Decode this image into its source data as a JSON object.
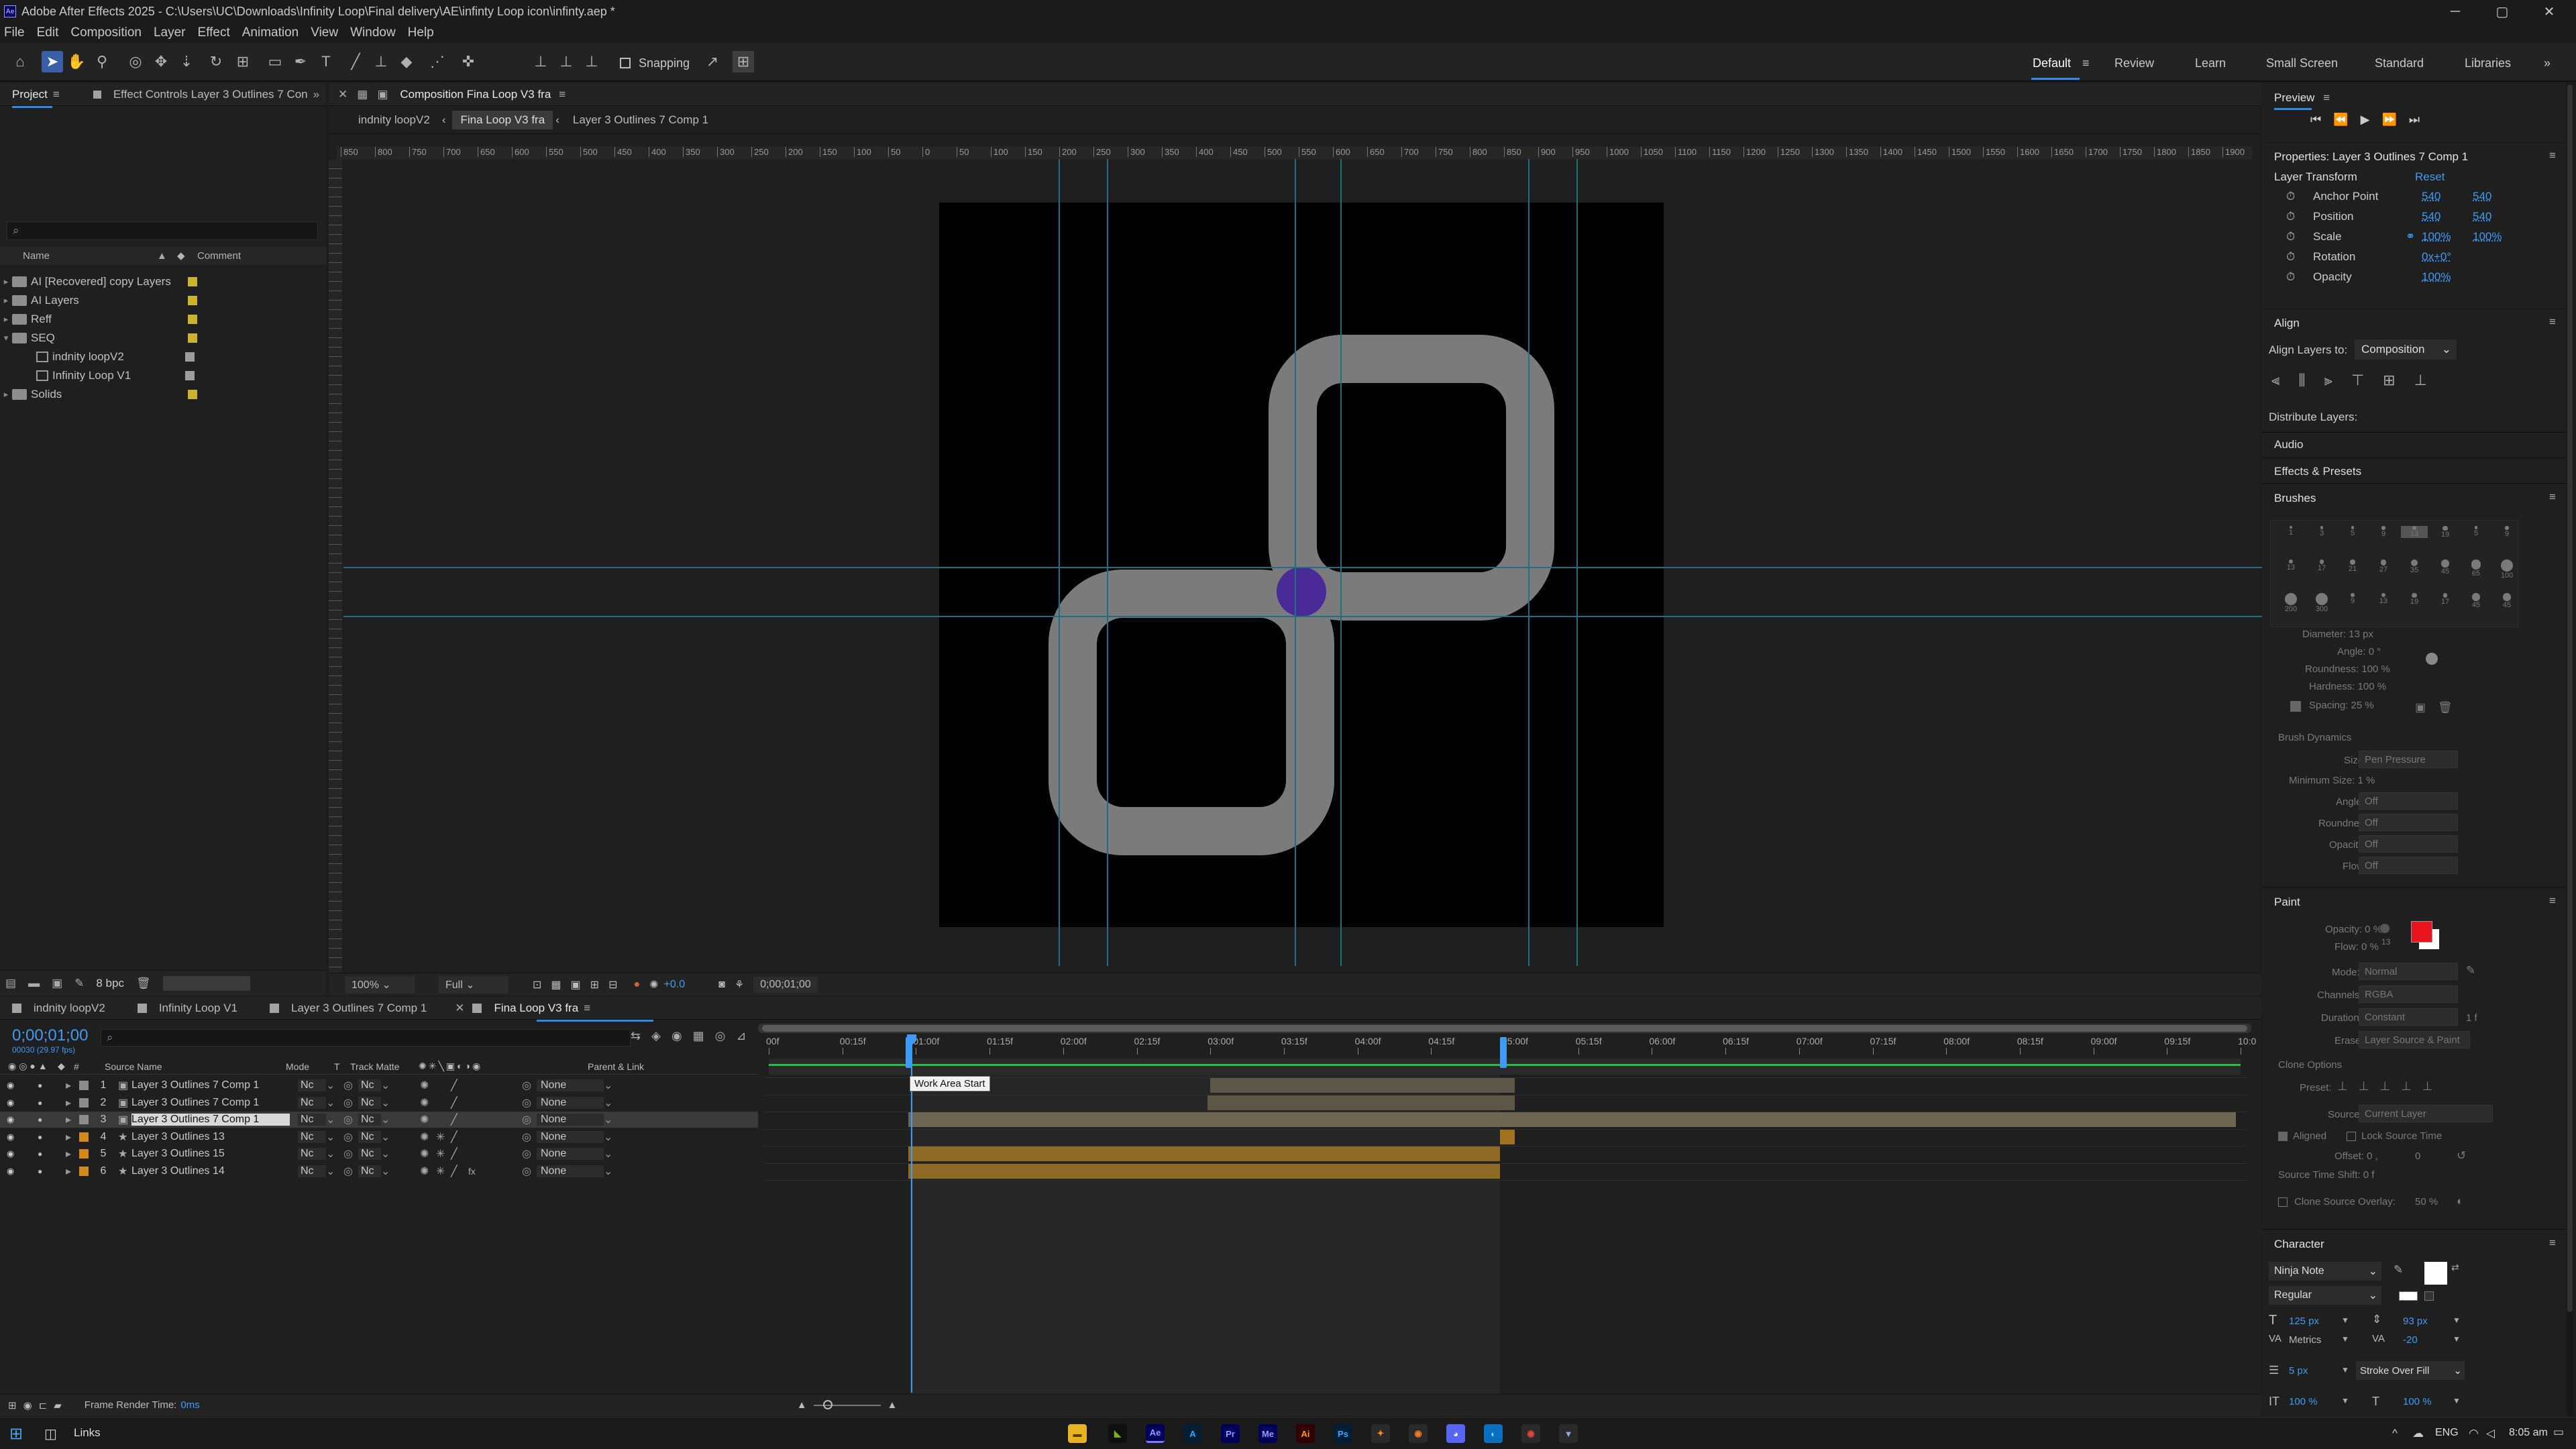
{
  "title_bar": {
    "title": "Adobe After Effects 2025 - C:\\Users\\UC\\Downloads\\Infinity Loop\\Final delivery\\AE\\infinty Loop icon\\infinty.aep *",
    "minimize": "─",
    "maximize": "▢",
    "close": "✕",
    "app_icon": "Ae"
  },
  "menu": [
    "File",
    "Edit",
    "Composition",
    "Layer",
    "Effect",
    "Animation",
    "View",
    "Window",
    "Help"
  ],
  "toolbar": {
    "snapping_label": "Snapping",
    "workspaces": [
      "Default",
      "Review",
      "Learn",
      "Small Screen",
      "Standard",
      "Libraries"
    ],
    "more": "»"
  },
  "project_panel": {
    "tabs": [
      "Project",
      "Effect Controls Layer 3 Outlines 7 Con"
    ],
    "search_placeholder": "⌕",
    "columns": {
      "name": "Name",
      "comment": "Comment"
    },
    "items": [
      {
        "name": "AI [Recovered] copy Layers",
        "type": "folder",
        "expanded": false
      },
      {
        "name": "AI Layers",
        "type": "folder",
        "expanded": false
      },
      {
        "name": "Reff",
        "type": "folder",
        "expanded": false
      },
      {
        "name": "SEQ",
        "type": "folder",
        "expanded": true
      },
      {
        "name": "indnity loopV2",
        "type": "comp",
        "child": true
      },
      {
        "name": "Infinity Loop V1",
        "type": "comp",
        "child": true
      },
      {
        "name": "Solids",
        "type": "folder",
        "expanded": false
      }
    ],
    "bpc": "8 bpc"
  },
  "composition_panel": {
    "header": "Composition Fina Loop V3 fra",
    "breadcrumbs": [
      "indnity loopV2",
      "Fina Loop V3 fra",
      "Layer 3 Outlines 7 Comp 1"
    ],
    "ruler_labels": [
      "850",
      "800",
      "750",
      "700",
      "650",
      "600",
      "550",
      "500",
      "450",
      "400",
      "350",
      "300",
      "250",
      "200",
      "150",
      "100",
      "50",
      "0",
      "50",
      "100",
      "150",
      "200",
      "250",
      "300",
      "350",
      "400",
      "450",
      "500",
      "550",
      "600",
      "650",
      "700",
      "750",
      "800",
      "850",
      "900",
      "950",
      "1000",
      "1050",
      "1100",
      "1150",
      "1200",
      "1250",
      "1300",
      "1350",
      "1400",
      "1450",
      "1500",
      "1550",
      "1600",
      "1650",
      "1700",
      "1750",
      "1800",
      "1850",
      "1900"
    ],
    "footer": {
      "zoom": "100%",
      "quality": "Full",
      "exposure": "+0.0",
      "timecode": "0;00;01;00"
    }
  },
  "right_panel": {
    "preview_title": "Preview",
    "properties": {
      "title": "Properties: Layer 3 Outlines 7 Comp 1",
      "section": "Layer Transform",
      "reset": "Reset",
      "rows": [
        {
          "label": "Anchor Point",
          "v1": "540",
          "v2": "540"
        },
        {
          "label": "Position",
          "v1": "540",
          "v2": "540"
        },
        {
          "label": "Scale",
          "v1": "100%",
          "v2": "100%"
        },
        {
          "label": "Rotation",
          "v1": "0x+0°",
          "v2": ""
        },
        {
          "label": "Opacity",
          "v1": "100%",
          "v2": ""
        }
      ]
    },
    "align": {
      "title": "Align",
      "align_to_label": "Align Layers to:",
      "align_to_value": "Composition",
      "distribute": "Distribute Layers:"
    },
    "audio": "Audio",
    "effects_presets": "Effects & Presets",
    "brushes": {
      "title": "Brushes",
      "sizes": [
        "1",
        "3",
        "5",
        "9",
        "13",
        "19",
        "5",
        "9",
        "13",
        "17",
        "21",
        "27",
        "35",
        "45",
        "65",
        "100",
        "200",
        "300",
        "9",
        "13",
        "19",
        "17",
        "45",
        "45"
      ],
      "diameter": "Diameter: 13 px",
      "angle": "Angle: 0 °",
      "roundness": "Roundness: 100 %",
      "hardness": "Hardness: 100 %",
      "spacing": "Spacing: 25 %",
      "dynamics_title": "Brush Dynamics",
      "size_label": "Size:",
      "size_value": "Pen Pressure",
      "min_size": "Minimum Size: 1 %",
      "angle_label": "Angle:",
      "roundness_label": "Roundness:",
      "opacity_label": "Opacity:",
      "flow_label": "Flow:",
      "off": "Off"
    },
    "paint": {
      "title": "Paint",
      "opacity": "Opacity: 0 %",
      "flow": "Flow: 0 %",
      "brush_size": "13",
      "mode_label": "Mode:",
      "mode_value": "Normal",
      "channels_label": "Channels:",
      "channels_value": "RGBA",
      "duration_label": "Duration:",
      "duration_value": "Constant",
      "duration_suffix": "1 f",
      "erase_label": "Erase:",
      "erase_value": "Layer Source & Paint",
      "clone_options": "Clone Options",
      "preset_label": "Preset:",
      "source_label": "Source:",
      "source_value": "Current Layer",
      "aligned": "Aligned",
      "lock_source_time": "Lock Source Time",
      "offset": "Offset: 0 ,",
      "offset_y": "0",
      "source_time_shift": "Source Time Shift: 0 f",
      "clone_overlay": "Clone Source Overlay:",
      "clone_overlay_value": "50 %",
      "fg_color": "#e8141e",
      "bg_color": "#ffffff"
    },
    "character": {
      "title": "Character",
      "font": "Ninja Note",
      "style": "Regular",
      "size": "125 px",
      "leading": "93 px",
      "kerning": "Metrics",
      "tracking": "-20",
      "stroke": "5 px",
      "stroke_type": "Stroke Over Fill",
      "vscale": "100 %",
      "hscale": "100 %"
    }
  },
  "timeline": {
    "tabs": [
      "indnity loopV2",
      "Infinity Loop V1",
      "Layer 3 Outlines 7 Comp 1",
      "Fina Loop V3 fra"
    ],
    "timecode": "0;00;01;00",
    "fps": "00030 (29.97 fps)",
    "search_placeholder": "⌕",
    "columns": {
      "num": "#",
      "source_name": "Source Name",
      "mode": "Mode",
      "t": "T",
      "track_matte": "Track Matte",
      "parent": "Parent & Link"
    },
    "time_labels": [
      "00f",
      "00:15f",
      "01:00f",
      "01:15f",
      "02:00f",
      "02:15f",
      "03:00f",
      "03:15f",
      "04:00f",
      "04:15f",
      "05:00f",
      "05:15f",
      "06:00f",
      "06:15f",
      "07:00f",
      "07:15f",
      "08:00f",
      "08:15f",
      "09:00f",
      "09:15f",
      "10:0"
    ],
    "layers": [
      {
        "num": "1",
        "name": "Layer 3 Outlines 7 Comp 1",
        "type": "comp",
        "color": "#8c8c8c",
        "mode": "Nc",
        "matte": "Nc",
        "parent": "None",
        "selected": false,
        "bar_start": 0.3,
        "bar_end": 0.507,
        "bar_color": "#5d5545"
      },
      {
        "num": "2",
        "name": "Layer 3 Outlines 7 Comp 1",
        "type": "comp",
        "color": "#8c8c8c",
        "mode": "Nc",
        "matte": "Nc",
        "parent": "None",
        "selected": false,
        "bar_start": 0.298,
        "bar_end": 0.507,
        "bar_color": "#5d5545"
      },
      {
        "num": "3",
        "name": "Layer 3 Outlines 7 Comp 1",
        "type": "comp",
        "color": "#8c8c8c",
        "mode": "Nc",
        "matte": "Nc",
        "parent": "None",
        "selected": true,
        "bar_start": 0.095,
        "bar_end": 0.997,
        "bar_color": "#6e6552"
      },
      {
        "num": "4",
        "name": "Layer 3 Outlines 13",
        "type": "shape",
        "color": "#d48a1a",
        "mode": "Nc",
        "matte": "Nc",
        "parent": "None",
        "selected": false,
        "bar_start": 0.497,
        "bar_end": 0.507,
        "bar_color": "#a0721f"
      },
      {
        "num": "5",
        "name": "Layer 3 Outlines 15",
        "type": "shape",
        "color": "#d48a1a",
        "mode": "Nc",
        "matte": "Nc",
        "parent": "None",
        "selected": false,
        "bar_start": 0.095,
        "bar_end": 0.497,
        "bar_color": "#8e6a25"
      },
      {
        "num": "6",
        "name": "Layer 3 Outlines 14",
        "type": "shape",
        "color": "#d48a1a",
        "mode": "Nc",
        "matte": "Nc",
        "parent": "None",
        "selected": false,
        "bar_start": 0.095,
        "bar_end": 0.497,
        "bar_color": "#8e6a25"
      }
    ],
    "tooltip": "Work Area Start",
    "footer": {
      "frame_render_label": "Frame Render Time:",
      "frame_render_value": "0ms"
    }
  },
  "taskbar": {
    "search_label": "Links",
    "lang": "ENG",
    "time": "8:05 am"
  },
  "colors": {
    "accent": "#2d8ceb",
    "canvas": "#000000",
    "loop": "#7b7b7b",
    "dot": "#4a2a96"
  }
}
